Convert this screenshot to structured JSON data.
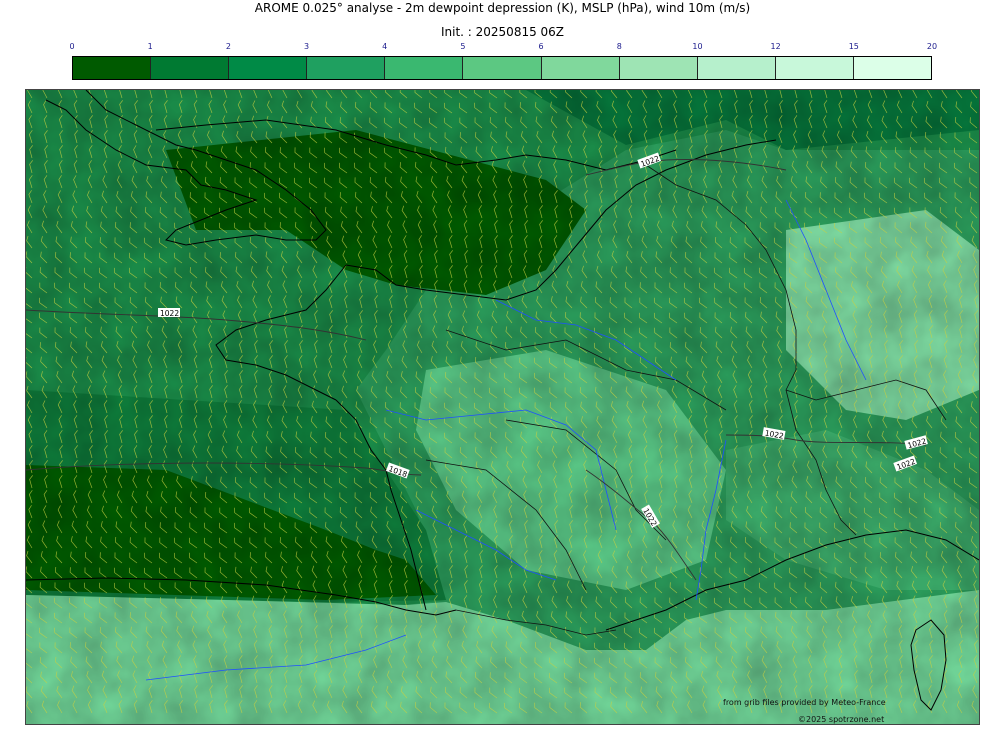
{
  "header": {
    "title": "AROME 0.025° analyse - 2m dewpoint depression (K), MSLP (hPa), wind 10m (m/s)",
    "subtitle": "Init. : 20250815 06Z"
  },
  "colorbar": {
    "ticks": [
      "0",
      "1",
      "2",
      "3",
      "4",
      "5",
      "6",
      "8",
      "10",
      "12",
      "15",
      "20"
    ],
    "colors": [
      "#005a00",
      "#007a32",
      "#008a46",
      "#1fa060",
      "#3ab870",
      "#5cc882",
      "#80d89c",
      "#9ee4b4",
      "#b6f0cc",
      "#c8f8da",
      "#dcffe8"
    ]
  },
  "map": {
    "isobar_labels": [
      "1022",
      "1022",
      "1018",
      "1022",
      "1022",
      "1022",
      "1022"
    ],
    "credits": {
      "line1": "from grib files provided by Meteo-France",
      "line2": "©2025 spotrzone.net"
    },
    "colors": {
      "coast": "#000000",
      "rivers": "#2050ff",
      "wind_barbs": "#c8d040",
      "isobars": "#333333"
    }
  }
}
